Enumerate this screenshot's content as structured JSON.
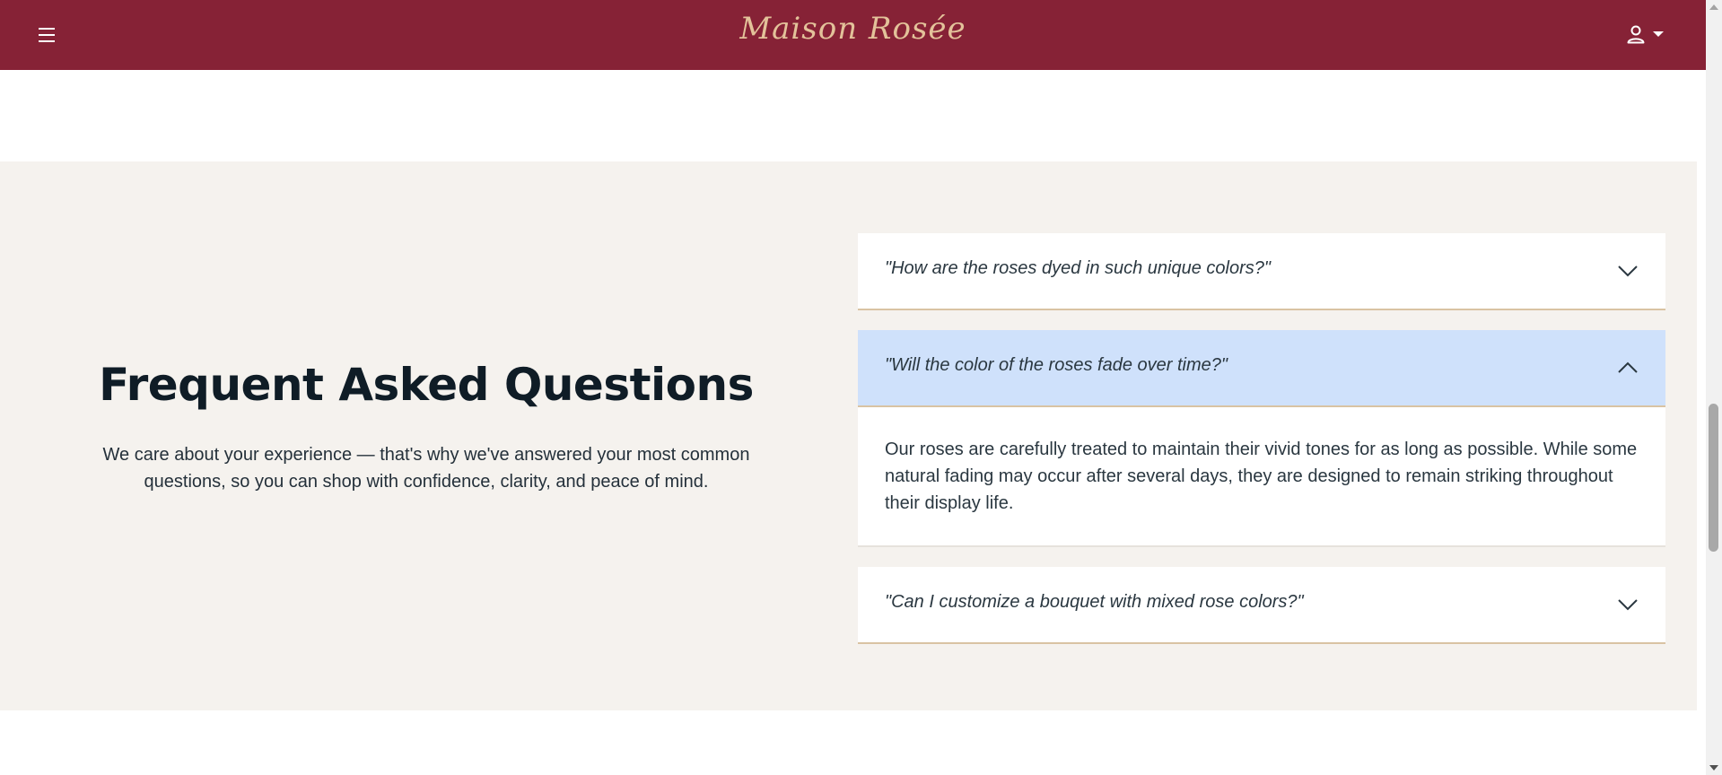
{
  "header": {
    "brand": "Maison Rosée",
    "menu_icon": "hamburger-icon",
    "account_icon": "user-icon",
    "background": "#862236",
    "brand_color": "#e3c29a"
  },
  "faq": {
    "title": "Frequent Asked Questions",
    "subtitle": "We care about your experience — that's why we've answered your most common questions, so you can shop with confidence, clarity, and peace of mind.",
    "items": [
      {
        "question": "\"How are the roses dyed in such unique colors?\"",
        "expanded": false
      },
      {
        "question": "\"Will the color of the roses fade over time?\"",
        "expanded": true,
        "answer": "Our roses are carefully treated to maintain their vivid tones for as long as possible. While some natural fading may occur after several days, they are designed to remain striking throughout their display life."
      },
      {
        "question": "\"Can I customize a bouquet with mixed rose colors?\"",
        "expanded": false
      }
    ],
    "section_background": "#f5f2ee",
    "active_item_background": "#cfe1fb",
    "divider_color": "#d9c3a3"
  }
}
